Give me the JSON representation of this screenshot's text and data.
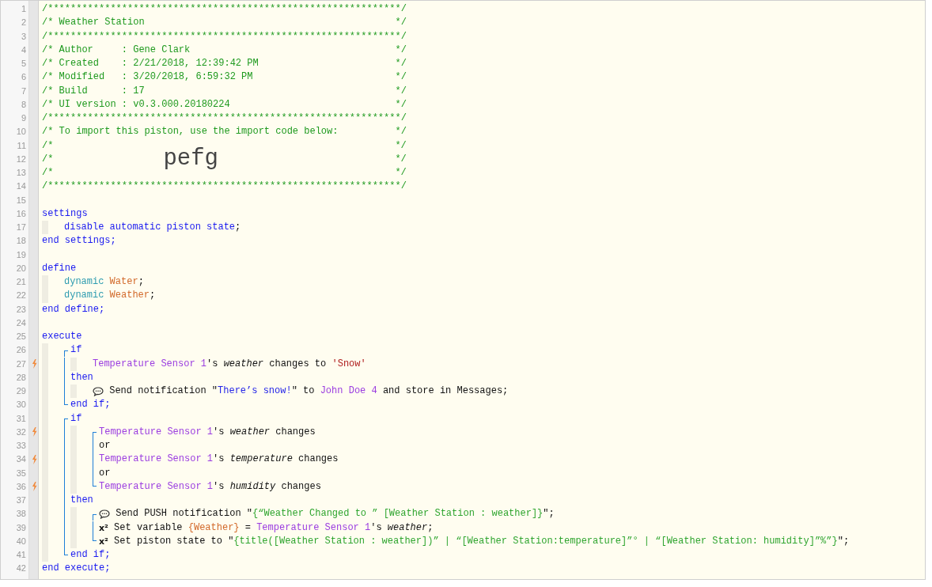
{
  "code": [
    {
      "kind": "line",
      "num": "1",
      "trigger": false,
      "segments": [
        {
          "kind": "comment",
          "text": "/**************************************************************/"
        }
      ]
    },
    {
      "kind": "line",
      "num": "2",
      "trigger": false,
      "segments": [
        {
          "kind": "comment",
          "text": "/* Weather Station                                            */"
        }
      ]
    },
    {
      "kind": "line",
      "num": "3",
      "trigger": false,
      "segments": [
        {
          "kind": "comment",
          "text": "/**************************************************************/"
        }
      ]
    },
    {
      "kind": "line",
      "num": "4",
      "trigger": false,
      "segments": [
        {
          "kind": "comment",
          "text": "/* Author     : Gene Clark                                    */"
        }
      ]
    },
    {
      "kind": "line",
      "num": "5",
      "trigger": false,
      "segments": [
        {
          "kind": "comment",
          "text": "/* Created    : 2/21/2018, 12:39:42 PM                        */"
        }
      ]
    },
    {
      "kind": "line",
      "num": "6",
      "trigger": false,
      "segments": [
        {
          "kind": "comment",
          "text": "/* Modified   : 3/20/2018, 6:59:32 PM                         */"
        }
      ]
    },
    {
      "kind": "line",
      "num": "7",
      "trigger": false,
      "segments": [
        {
          "kind": "comment",
          "text": "/* Build      : 17                                            */"
        }
      ]
    },
    {
      "kind": "line",
      "num": "8",
      "trigger": false,
      "segments": [
        {
          "kind": "comment",
          "text": "/* UI version : v0.3.000.20180224                             */"
        }
      ]
    },
    {
      "kind": "line",
      "num": "9",
      "trigger": false,
      "segments": [
        {
          "kind": "comment",
          "text": "/**************************************************************/"
        }
      ]
    },
    {
      "kind": "line",
      "num": "10",
      "trigger": false,
      "segments": [
        {
          "kind": "comment",
          "text": "/* To import this piston, use the import code below:          */"
        }
      ]
    },
    {
      "kind": "line",
      "num": "11",
      "trigger": false,
      "segments": [
        {
          "kind": "comment-open",
          "text": "/*"
        },
        {
          "kind": "comment",
          "text": "*/"
        }
      ]
    },
    {
      "kind": "line",
      "num": "12",
      "trigger": false,
      "segments": [
        {
          "kind": "comment",
          "text": "/*"
        },
        {
          "kind": "import-code",
          "text": "pefg"
        },
        {
          "kind": "comment",
          "text": "*/"
        }
      ]
    },
    {
      "kind": "line",
      "num": "13",
      "trigger": false,
      "segments": [
        {
          "kind": "comment-open",
          "text": "/*"
        },
        {
          "kind": "comment",
          "text": "*/"
        }
      ]
    },
    {
      "kind": "line",
      "num": "14",
      "trigger": false,
      "segments": [
        {
          "kind": "comment",
          "text": "/**************************************************************/"
        }
      ]
    },
    {
      "kind": "line",
      "num": "15",
      "trigger": false
    },
    {
      "kind": "line",
      "num": "16",
      "trigger": false,
      "segments": [
        {
          "kind": "keyword",
          "text": "settings"
        }
      ],
      "children": [
        {
          "kind": "line",
          "num": "17",
          "trigger": false,
          "segments": [
            {
              "kind": "keyword",
              "text": "disable automatic piston state"
            },
            {
              "kind": "plain",
              "text": ";"
            }
          ]
        }
      ]
    },
    {
      "kind": "line",
      "num": "18",
      "trigger": false,
      "segments": [
        {
          "kind": "keyword",
          "text": "end settings;"
        }
      ]
    },
    {
      "kind": "line",
      "num": "19",
      "trigger": false
    },
    {
      "kind": "line",
      "num": "20",
      "trigger": false,
      "segments": [
        {
          "kind": "keyword",
          "text": "define"
        }
      ],
      "children": [
        {
          "kind": "line",
          "num": "21",
          "trigger": false,
          "segments": [
            {
              "kind": "type",
              "text": "dynamic"
            },
            {
              "kind": "variable",
              "text": "Water"
            },
            {
              "kind": "plain",
              "text": ";"
            }
          ]
        },
        {
          "kind": "line",
          "num": "22",
          "trigger": false,
          "segments": [
            {
              "kind": "type",
              "text": "dynamic"
            },
            {
              "kind": "variable",
              "text": "Weather"
            },
            {
              "kind": "plain",
              "text": ";"
            }
          ]
        }
      ]
    },
    {
      "kind": "line",
      "num": "23",
      "trigger": false,
      "segments": [
        {
          "kind": "keyword",
          "text": "end define;"
        }
      ]
    },
    {
      "kind": "line",
      "num": "24",
      "trigger": false
    },
    {
      "kind": "line",
      "num": "25",
      "trigger": false,
      "segments": [
        {
          "kind": "keyword",
          "text": "execute"
        }
      ],
      "children": [
        {
          "kind": "bracket",
          "children": [
            {
              "kind": "line",
              "num": "26",
              "trigger": false,
              "segments": [
                {
                  "kind": "keyword",
                  "text": "if"
                }
              ],
              "children": [
                {
                  "kind": "line",
                  "num": "27",
                  "trigger": true,
                  "segments": [
                    {
                      "kind": "device",
                      "text": "Temperature Sensor 1"
                    },
                    {
                      "kind": "plain",
                      "text": "'s "
                    },
                    {
                      "kind": "attribute",
                      "text": "weather"
                    },
                    {
                      "kind": "plain",
                      "text": " changes to "
                    },
                    {
                      "kind": "literal",
                      "text": "'Snow'"
                    }
                  ]
                }
              ]
            },
            {
              "kind": "line",
              "num": "28",
              "trigger": false,
              "segments": [
                {
                  "kind": "keyword",
                  "text": "then"
                }
              ],
              "children": [
                {
                  "kind": "line",
                  "num": "29",
                  "trigger": false,
                  "segments": [
                    {
                      "kind": "chat"
                    },
                    {
                      "kind": "plain",
                      "text": " Send notification \""
                    },
                    {
                      "kind": "message",
                      "text": "There’s snow!"
                    },
                    {
                      "kind": "plain",
                      "text": "\" to "
                    },
                    {
                      "kind": "device",
                      "text": "John Doe 4"
                    },
                    {
                      "kind": "plain",
                      "text": " and store in Messages;"
                    }
                  ]
                }
              ]
            },
            {
              "kind": "line",
              "num": "30",
              "trigger": false,
              "segments": [
                {
                  "kind": "keyword",
                  "text": "end if;"
                }
              ]
            }
          ]
        },
        {
          "kind": "bracket",
          "children": [
            {
              "kind": "line",
              "num": "31",
              "trigger": false,
              "segments": [
                {
                  "kind": "keyword",
                  "text": "if"
                }
              ],
              "children": [
                {
                  "kind": "bracket",
                  "children": [
                    {
                      "kind": "line",
                      "num": "32",
                      "trigger": true,
                      "segments": [
                        {
                          "kind": "device",
                          "text": "Temperature Sensor 1"
                        },
                        {
                          "kind": "plain",
                          "text": "'s "
                        },
                        {
                          "kind": "attribute",
                          "text": "weather"
                        },
                        {
                          "kind": "plain",
                          "text": " changes"
                        }
                      ]
                    },
                    {
                      "kind": "line",
                      "num": "33",
                      "trigger": false,
                      "segments": [
                        {
                          "kind": "plain",
                          "text": "or"
                        }
                      ]
                    },
                    {
                      "kind": "line",
                      "num": "34",
                      "trigger": true,
                      "segments": [
                        {
                          "kind": "device",
                          "text": "Temperature Sensor 1"
                        },
                        {
                          "kind": "plain",
                          "text": "'s "
                        },
                        {
                          "kind": "attribute",
                          "text": "temperature"
                        },
                        {
                          "kind": "plain",
                          "text": " changes"
                        }
                      ]
                    },
                    {
                      "kind": "line",
                      "num": "35",
                      "trigger": false,
                      "segments": [
                        {
                          "kind": "plain",
                          "text": "or"
                        }
                      ]
                    },
                    {
                      "kind": "line",
                      "num": "36",
                      "trigger": true,
                      "segments": [
                        {
                          "kind": "device",
                          "text": "Temperature Sensor 1"
                        },
                        {
                          "kind": "plain",
                          "text": "'s "
                        },
                        {
                          "kind": "attribute",
                          "text": "humidity"
                        },
                        {
                          "kind": "plain",
                          "text": " changes"
                        }
                      ]
                    }
                  ]
                }
              ]
            },
            {
              "kind": "line",
              "num": "37",
              "trigger": false,
              "segments": [
                {
                  "kind": "keyword",
                  "text": "then"
                }
              ],
              "children": [
                {
                  "kind": "bracket",
                  "children": [
                    {
                      "kind": "line",
                      "num": "38",
                      "trigger": false,
                      "segments": [
                        {
                          "kind": "chat"
                        },
                        {
                          "kind": "plain",
                          "text": " Send PUSH notification \""
                        },
                        {
                          "kind": "string",
                          "text": "{“Weather Changed to ” [Weather Station : weather]}"
                        },
                        {
                          "kind": "plain",
                          "text": "\";"
                        }
                      ]
                    },
                    {
                      "kind": "line",
                      "num": "39",
                      "trigger": false,
                      "segments": [
                        {
                          "kind": "operation",
                          "text": "x²"
                        },
                        {
                          "kind": "plain",
                          "text": " Set variable "
                        },
                        {
                          "kind": "variable",
                          "text": "{Weather}"
                        },
                        {
                          "kind": "plain",
                          "text": " = "
                        },
                        {
                          "kind": "device",
                          "text": "Temperature Sensor 1"
                        },
                        {
                          "kind": "plain",
                          "text": "'s "
                        },
                        {
                          "kind": "attribute",
                          "text": "weather"
                        },
                        {
                          "kind": "plain",
                          "text": ";"
                        }
                      ]
                    },
                    {
                      "kind": "line",
                      "num": "40",
                      "trigger": false,
                      "segments": [
                        {
                          "kind": "operation",
                          "text": "x²"
                        },
                        {
                          "kind": "plain",
                          "text": " Set piston state to \""
                        },
                        {
                          "kind": "string",
                          "text": "{title([Weather Station : weather])” | “[Weather Station:temperature]”° | “[Weather Station: humidity]”%”}"
                        },
                        {
                          "kind": "plain",
                          "text": "\";"
                        }
                      ]
                    }
                  ]
                }
              ]
            },
            {
              "kind": "line",
              "num": "41",
              "trigger": false,
              "segments": [
                {
                  "kind": "keyword",
                  "text": "end if;"
                }
              ]
            }
          ]
        }
      ]
    },
    {
      "kind": "line",
      "num": "42",
      "trigger": false,
      "segments": [
        {
          "kind": "keyword",
          "text": "end execute;"
        }
      ]
    }
  ]
}
